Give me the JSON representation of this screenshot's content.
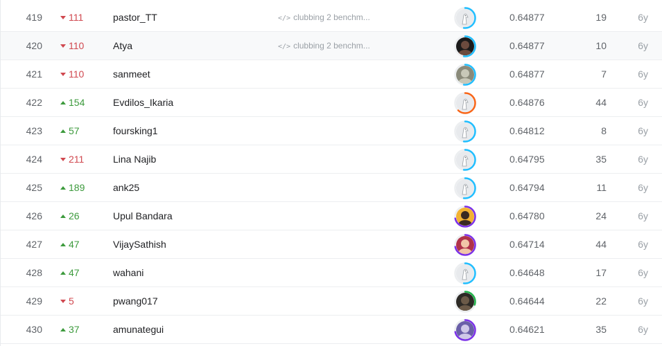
{
  "colors": {
    "up": "#3c9a3c",
    "down": "#d0484f",
    "ring_contributor": "#20beff",
    "ring_expert": "#f96517",
    "ring_master": "#7b30e8",
    "ring_novice": "#21b34a"
  },
  "rows": [
    {
      "rank": "419",
      "direction": "down",
      "delta": "111",
      "team": "pastor_TT",
      "kernel": "clubbing 2 benchm...",
      "kernel_icon": "code-icon",
      "avatar": "default-avatar",
      "tier": "contributor",
      "score": "0.64877",
      "entries": "19",
      "last": "6y"
    },
    {
      "rank": "420",
      "direction": "down",
      "delta": "110",
      "team": "Atya",
      "kernel": "clubbing 2 benchm...",
      "kernel_icon": "code-icon",
      "avatar": "photo-avatar",
      "tier": "contributor",
      "score": "0.64877",
      "entries": "10",
      "last": "6y"
    },
    {
      "rank": "421",
      "direction": "down",
      "delta": "110",
      "team": "sanmeet",
      "kernel": "",
      "avatar": "photo-avatar",
      "tier": "contributor",
      "score": "0.64877",
      "entries": "7",
      "last": "6y"
    },
    {
      "rank": "422",
      "direction": "up",
      "delta": "154",
      "team": "Evdilos_Ikaria",
      "kernel": "",
      "avatar": "default-avatar",
      "tier": "expert",
      "score": "0.64876",
      "entries": "44",
      "last": "6y"
    },
    {
      "rank": "423",
      "direction": "up",
      "delta": "57",
      "team": "foursking1",
      "kernel": "",
      "avatar": "default-avatar",
      "tier": "contributor",
      "score": "0.64812",
      "entries": "8",
      "last": "6y"
    },
    {
      "rank": "424",
      "direction": "down",
      "delta": "211",
      "team": "Lina Najib",
      "kernel": "",
      "avatar": "default-avatar",
      "tier": "contributor",
      "score": "0.64795",
      "entries": "35",
      "last": "6y"
    },
    {
      "rank": "425",
      "direction": "up",
      "delta": "189",
      "team": "ank25",
      "kernel": "",
      "avatar": "default-avatar",
      "tier": "contributor",
      "score": "0.64794",
      "entries": "11",
      "last": "6y"
    },
    {
      "rank": "426",
      "direction": "up",
      "delta": "26",
      "team": "Upul Bandara",
      "kernel": "",
      "avatar": "photo-avatar",
      "tier": "master",
      "score": "0.64780",
      "entries": "24",
      "last": "6y"
    },
    {
      "rank": "427",
      "direction": "up",
      "delta": "47",
      "team": "VijaySathish",
      "kernel": "",
      "avatar": "photo-avatar",
      "tier": "master",
      "score": "0.64714",
      "entries": "44",
      "last": "6y"
    },
    {
      "rank": "428",
      "direction": "up",
      "delta": "47",
      "team": "wahani",
      "kernel": "",
      "avatar": "default-avatar",
      "tier": "contributor",
      "score": "0.64648",
      "entries": "17",
      "last": "6y"
    },
    {
      "rank": "429",
      "direction": "down",
      "delta": "5",
      "team": "pwang017",
      "kernel": "",
      "avatar": "photo-avatar",
      "tier": "novice",
      "score": "0.64644",
      "entries": "22",
      "last": "6y"
    },
    {
      "rank": "430",
      "direction": "up",
      "delta": "37",
      "team": "amunategui",
      "kernel": "",
      "avatar": "photo-avatar",
      "tier": "master",
      "score": "0.64621",
      "entries": "35",
      "last": "6y"
    }
  ]
}
